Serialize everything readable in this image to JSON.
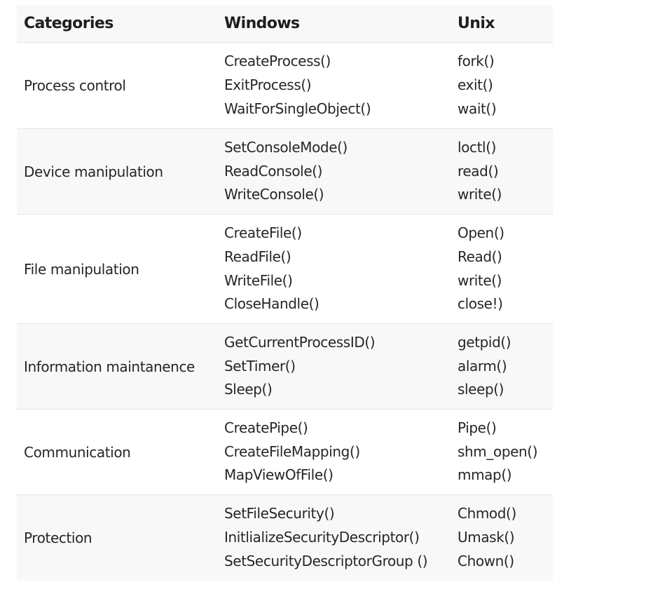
{
  "headers": {
    "categories": "Categories",
    "windows": "Windows",
    "unix": "Unix"
  },
  "rows": [
    {
      "category": "Process control",
      "windows": [
        "CreateProcess()",
        "ExitProcess()",
        "WaitForSingleObject()"
      ],
      "unix": [
        "fork()",
        "exit()",
        "wait()"
      ]
    },
    {
      "category": "Device manipulation",
      "windows": [
        "SetConsoleMode()",
        "ReadConsole()",
        "WriteConsole()"
      ],
      "unix": [
        "loctl()",
        "read()",
        "write()"
      ]
    },
    {
      "category": "File manipulation",
      "windows": [
        "CreateFile()",
        "ReadFile()",
        "WriteFile()",
        "CloseHandle()"
      ],
      "unix": [
        "Open()",
        "Read()",
        "write()",
        "close!)"
      ]
    },
    {
      "category": "Information maintanence",
      "windows": [
        "GetCurrentProcessID()",
        "SetTimer()",
        "Sleep()"
      ],
      "unix": [
        "getpid()",
        "alarm()",
        "sleep()"
      ]
    },
    {
      "category": "Communication",
      "windows": [
        "CreatePipe()",
        "CreateFileMapping()",
        "MapViewOfFile()"
      ],
      "unix": [
        "Pipe()",
        "shm_open()",
        "mmap()"
      ]
    },
    {
      "category": "Protection",
      "windows": [
        "SetFileSecurity()",
        "InitlializeSecurityDescriptor()",
        "SetSecurityDescriptorGroup ()"
      ],
      "unix": [
        "Chmod()",
        "Umask()",
        "Chown()"
      ]
    }
  ]
}
